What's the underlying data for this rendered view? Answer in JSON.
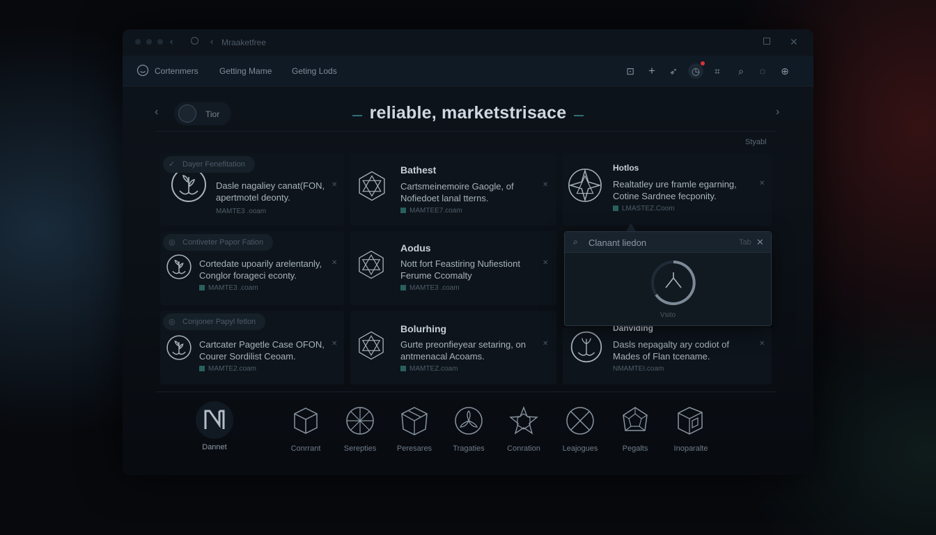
{
  "titlebar": {
    "title": "Mraaketfree"
  },
  "nav": {
    "items": [
      "Cortenmers",
      "Getting Mame",
      "Geting Lods"
    ]
  },
  "header": {
    "pill_label": "Tior",
    "title": "reliable, marketstrisace",
    "sort_label": "Styabl"
  },
  "cards": [
    {
      "tag": "Dayer Fenefitation",
      "heading": "",
      "text": "Dasle nagaliey canat(FON, apertmotel deonty.",
      "link": "MAMTE3 .ooam"
    },
    {
      "tag": "",
      "heading": "Bathest",
      "text": "Cartsmeinemoire Gaogle, of Nofiedoet lanal tterns.",
      "link": "MAMTEE7.coam"
    },
    {
      "tag": "",
      "heading": "Hotlos",
      "text": "Realtatley ure framle egarning, Cotine Sardnee fecponity.",
      "link": "LMASTEZ.Coom"
    },
    {
      "tag": "Contiveter Papor Fation",
      "heading": "",
      "text": "Cortedate upoarily arelentanly, Conglor forageci econty.",
      "link": "MAMTE3 .coam"
    },
    {
      "tag": "",
      "heading": "Aodus",
      "text": "Nott fort Feastiring Nufiestiont Ferume Ccomalty",
      "link": "MAMTE3 .coam"
    },
    {
      "tag": "Conjoner Papyl fetlon",
      "heading": "",
      "text": "Cartcater Pagetle Case OFON, Courer Sordilist Ceoam.",
      "link": "MAMTE2.coam"
    },
    {
      "tag": "",
      "heading": "Bolurhing",
      "text": "Gurte preonfieyear setaring, on antmenacal Acoams.",
      "link": "MAMTEZ.coam"
    },
    {
      "tag": "",
      "heading": "Danviding",
      "text": "Dasls nepagalty ary codiot of Mades of Flan tcename.",
      "link": "NMAMTEI.coam"
    }
  ],
  "popup": {
    "title": "Clanant liedon",
    "tab": "Tab",
    "status": "Vsito"
  },
  "categories": [
    {
      "label": "Dannet",
      "icon": "brand-logo-icon"
    },
    {
      "label": "Conrrant",
      "icon": "cube-icon"
    },
    {
      "label": "Serepties",
      "icon": "star-wheel-icon"
    },
    {
      "label": "Peresares",
      "icon": "box-icon"
    },
    {
      "label": "Tragaties",
      "icon": "propeller-icon"
    },
    {
      "label": "Conration",
      "icon": "star-cube-icon"
    },
    {
      "label": "Leajogues",
      "icon": "cross-circle-icon"
    },
    {
      "label": "Pegalts",
      "icon": "dodecahedron-icon"
    },
    {
      "label": "Inoparalte",
      "icon": "package-icon"
    }
  ],
  "colors": {
    "accent": "#2f6f7a",
    "notification": "#d8333a",
    "background": "#07090d"
  }
}
